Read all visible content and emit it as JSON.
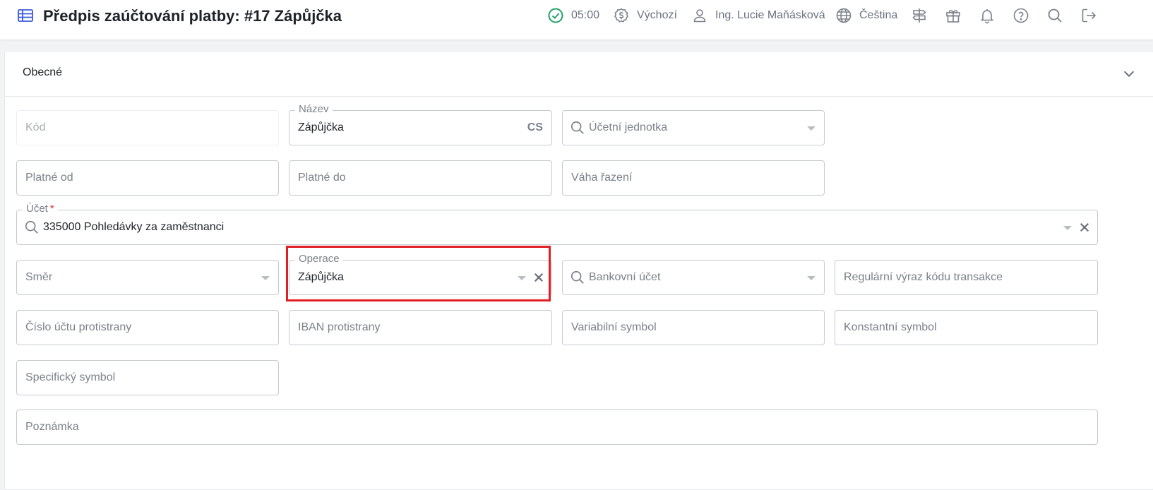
{
  "header": {
    "title": "Předpis zaúčtování platby: #17 Zápůjčka",
    "time": "05:00",
    "currency_profile": "Výchozí",
    "user": "Ing. Lucie Maňásková",
    "language": "Čeština",
    "icons": [
      "table-icon",
      "check-circle-icon",
      "dollar-badge-icon",
      "user-icon",
      "globe-icon",
      "signpost-icon",
      "gift-icon",
      "bell-icon",
      "help-icon",
      "search-icon",
      "logout-icon"
    ]
  },
  "section": {
    "title": "Obecné"
  },
  "fields": {
    "kod": {
      "placeholder": "Kód"
    },
    "nazev": {
      "label": "Název",
      "value": "Zápůjčka",
      "lang": "CS"
    },
    "ucetni_jednotka": {
      "placeholder": "Účetní jednotka"
    },
    "platne_od": {
      "placeholder": "Platné od"
    },
    "platne_do": {
      "placeholder": "Platné do"
    },
    "vaha_razeni": {
      "placeholder": "Váha řazení"
    },
    "ucet": {
      "label": "Účet",
      "required_mark": "*",
      "value": "335000 Pohledávky za zaměstnanci"
    },
    "smer": {
      "placeholder": "Směr"
    },
    "operace": {
      "label": "Operace",
      "value": "Zápůjčka"
    },
    "bankovni_ucet": {
      "placeholder": "Bankovní účet"
    },
    "regex": {
      "placeholder": "Regulární výraz kódu transakce"
    },
    "cislo_uctu": {
      "placeholder": "Číslo účtu protistrany"
    },
    "iban": {
      "placeholder": "IBAN protistrany"
    },
    "variabilni": {
      "placeholder": "Variabilní symbol"
    },
    "konstantni": {
      "placeholder": "Konstantní symbol"
    },
    "specificky": {
      "placeholder": "Specifický symbol"
    },
    "poznamka": {
      "placeholder": "Poznámka"
    }
  },
  "colors": {
    "accent_check": "#22a06b",
    "highlight": "#e01e24",
    "icon": "#7b818a"
  }
}
